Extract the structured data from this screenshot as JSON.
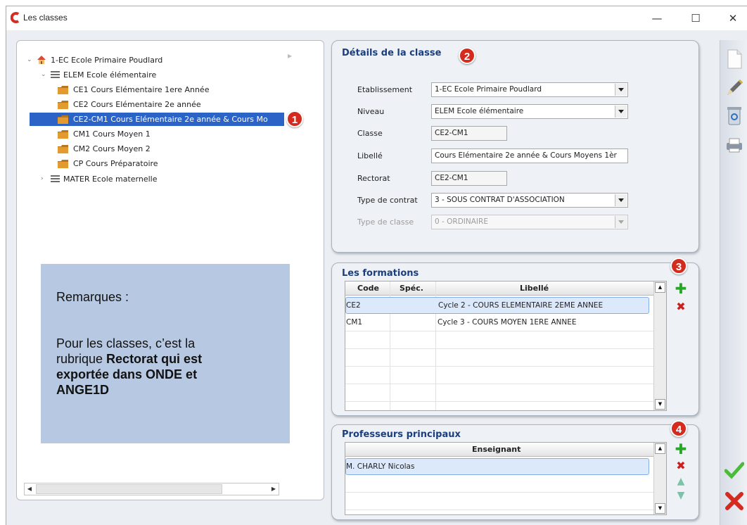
{
  "window": {
    "title": "Les classes",
    "minimize_glyph": "—",
    "maximize_glyph": "☐",
    "close_glyph": "✕"
  },
  "tree": {
    "root": "1-EC Ecole Primaire Poudlard",
    "level1": "ELEM Ecole élémentaire",
    "classes": [
      "CE1 Cours Elémentaire 1ere Année",
      "CE2 Cours Elémentaire 2e année",
      "CE2-CM1 Cours Elémentaire 2e année & Cours Mo",
      "CM1 Cours Moyen 1",
      "CM2 Cours Moyen 2",
      "CP Cours Préparatoire"
    ],
    "level1b": "MATER Ecole maternelle",
    "selected_index": 2
  },
  "remark": {
    "heading": "Remarques :",
    "line1": "Pour les classes, c’est la",
    "line2a": "rubrique ",
    "line2b": "Rectorat qui est",
    "line3": "exportée dans ONDE et",
    "line4": "ANGE1D"
  },
  "badges": [
    "1",
    "2",
    "3",
    "4"
  ],
  "details": {
    "title": "Détails de la classe",
    "etablissement_label": "Etablissement",
    "etablissement_value": "1-EC Ecole Primaire Poudlard",
    "niveau_label": "Niveau",
    "niveau_value": "ELEM Ecole élémentaire",
    "classe_label": "Classe",
    "classe_value": "CE2-CM1",
    "libelle_label": "Libellé",
    "libelle_value": "Cours Elémentaire 2e année & Cours Moyens 1èr",
    "rectorat_label": "Rectorat",
    "rectorat_value": "CE2-CM1",
    "contrat_label": "Type de contrat",
    "contrat_value": "3 - SOUS CONTRAT D'ASSOCIATION",
    "typeclasse_label": "Type de classe",
    "typeclasse_value": "0 - ORDINAIRE"
  },
  "formations": {
    "title": "Les formations",
    "columns": [
      "Code",
      "Spéc.",
      "Libellé"
    ],
    "rows": [
      {
        "code": "CE2",
        "spec": "",
        "libelle": "Cycle 2 - COURS ELEMENTAIRE 2EME ANNEE"
      },
      {
        "code": "CM1",
        "spec": "",
        "libelle": "Cycle 3 - COURS MOYEN 1ERE ANNEE"
      }
    ]
  },
  "professeurs": {
    "title": "Professeurs principaux",
    "column": "Enseignant",
    "rows": [
      "M. CHARLY Nicolas"
    ]
  },
  "toolbar_icons": [
    "new-document-icon",
    "edit-pen-icon",
    "trash-icon",
    "printer-icon",
    "validate-check-icon",
    "cancel-cross-icon"
  ],
  "colors": {
    "accent": "#1b3f7e",
    "selection": "#2b63c6",
    "badge": "#d52b1e",
    "remark_bg": "#b7c9e2"
  }
}
